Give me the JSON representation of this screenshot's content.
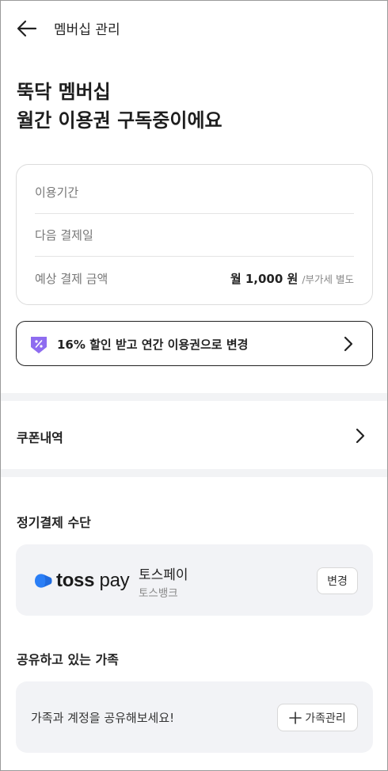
{
  "header": {
    "title": "멤버십 관리",
    "back_icon": "arrow-left-icon"
  },
  "hero": {
    "line1": "뚝닥 멤버십",
    "line2_highlight": "월간 이용권",
    "line2_rest": " 구독중이에요",
    "highlight_color": "#fbe84a"
  },
  "subscription": {
    "rows": [
      {
        "label": "이용기간",
        "value": ""
      },
      {
        "label": "다음 결제일",
        "value": ""
      },
      {
        "label": "예상 결제 금액",
        "value": "월 1,000 원",
        "note": "/부가세 별도"
      }
    ]
  },
  "promo": {
    "label": "16% 할인 받고 연간 이용권으로 변경",
    "icon": "discount-tag-icon",
    "icon_color": "#8e6cf0"
  },
  "coupon": {
    "label": "쿠폰내역"
  },
  "payment": {
    "section_title": "정기결제 수단",
    "logo_text_bold": "toss",
    "logo_text_light": " pay",
    "logo_color": "#2a7ef6",
    "method_name": "토스페이",
    "bank_name": "토스뱅크",
    "change_label": "변경"
  },
  "family": {
    "section_title": "공유하고 있는 가족",
    "message": "가족과 계정을 공유해보세요!",
    "manage_label": "가족관리"
  }
}
